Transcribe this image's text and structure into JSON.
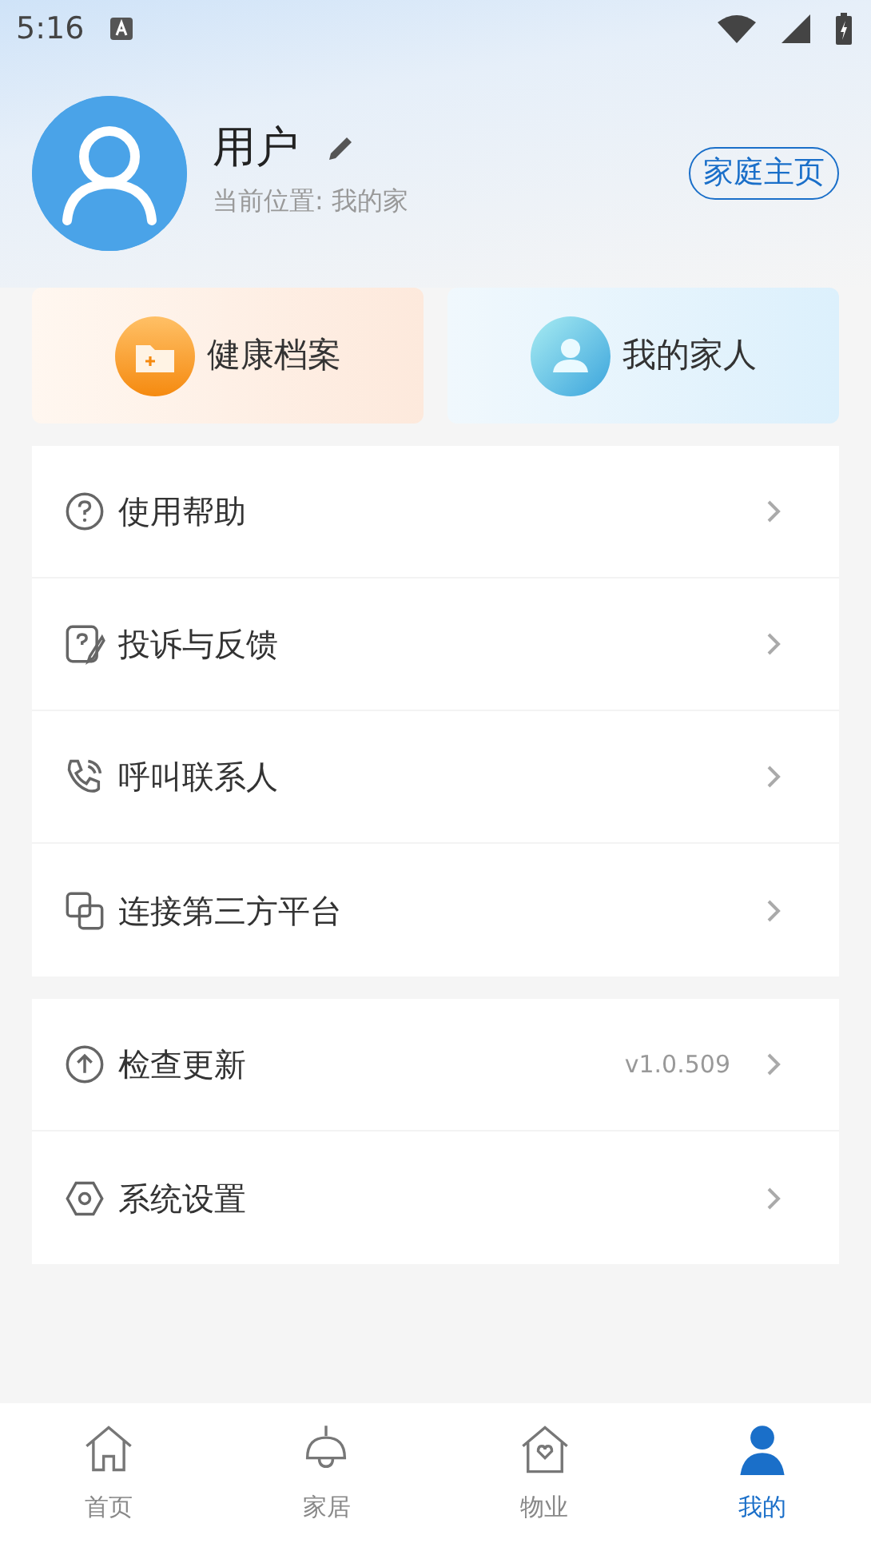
{
  "status_bar": {
    "time": "5:16"
  },
  "profile": {
    "name": "用户",
    "location": "当前位置: 我的家",
    "home_button": "家庭主页"
  },
  "shortcuts": [
    {
      "label": "健康档案"
    },
    {
      "label": "我的家人"
    }
  ],
  "menu_groups": [
    [
      {
        "label": "使用帮助"
      },
      {
        "label": "投诉与反馈"
      },
      {
        "label": "呼叫联系人"
      },
      {
        "label": "连接第三方平台"
      }
    ],
    [
      {
        "label": "检查更新",
        "value": "v1.0.509"
      },
      {
        "label": "系统设置"
      }
    ]
  ],
  "bottom_nav": [
    {
      "label": "首页",
      "selected": false
    },
    {
      "label": "家居",
      "selected": false
    },
    {
      "label": "物业",
      "selected": false
    },
    {
      "label": "我的",
      "selected": true
    }
  ]
}
